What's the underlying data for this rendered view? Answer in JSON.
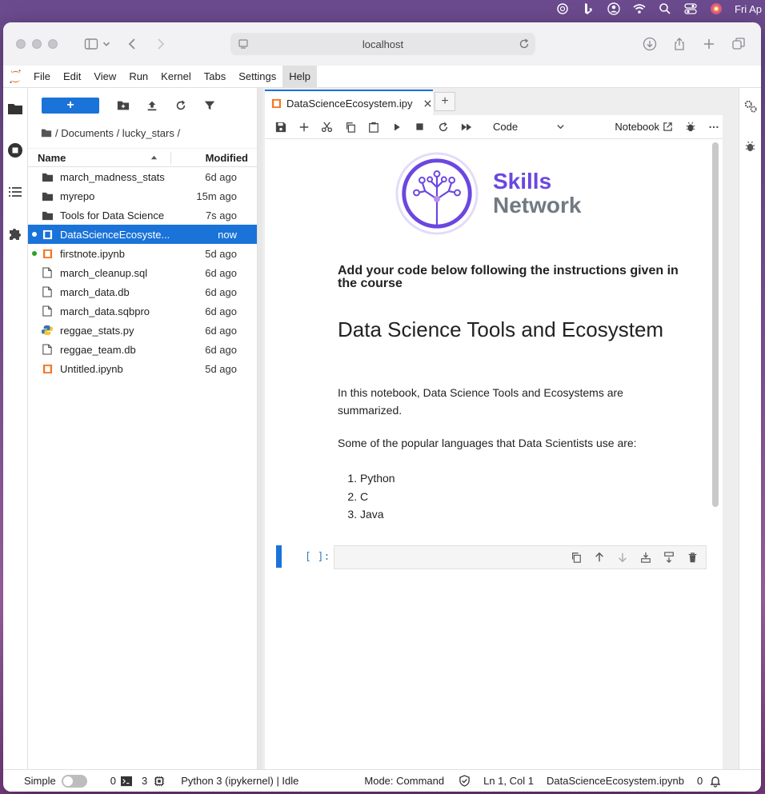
{
  "menubar": {
    "clock": "Fri Ap"
  },
  "browser": {
    "url": "localhost"
  },
  "jupyter_menu": [
    "File",
    "Edit",
    "View",
    "Run",
    "Kernel",
    "Tabs",
    "Settings",
    "Help"
  ],
  "active_menu": "Help",
  "filebrowser": {
    "new_label": "+",
    "breadcrumb": "/ Documents / lucky_stars /",
    "col_name": "Name",
    "col_modified": "Modified",
    "files": [
      {
        "name": "march_madness_stats",
        "modified": "6d ago",
        "type": "folder"
      },
      {
        "name": "myrepo",
        "modified": "15m ago",
        "type": "folder"
      },
      {
        "name": "Tools for Data Science",
        "modified": "7s ago",
        "type": "folder"
      },
      {
        "name": "DataScienceEcosyste...",
        "modified": "now",
        "type": "notebook",
        "selected": true,
        "dot": "#ffffff"
      },
      {
        "name": "firstnote.ipynb",
        "modified": "5d ago",
        "type": "notebook",
        "dot": "#2ca02c"
      },
      {
        "name": "march_cleanup.sql",
        "modified": "6d ago",
        "type": "file"
      },
      {
        "name": "march_data.db",
        "modified": "6d ago",
        "type": "file"
      },
      {
        "name": "march_data.sqbpro",
        "modified": "6d ago",
        "type": "file"
      },
      {
        "name": "reggae_stats.py",
        "modified": "6d ago",
        "type": "python"
      },
      {
        "name": "reggae_team.db",
        "modified": "6d ago",
        "type": "file"
      },
      {
        "name": "Untitled.ipynb",
        "modified": "5d ago",
        "type": "notebook"
      }
    ]
  },
  "tab": {
    "title": "DataScienceEcosystem.ipy"
  },
  "nbtoolbar": {
    "cell_type": "Code",
    "kernel_link": "Notebook"
  },
  "notebook": {
    "logo_line1": "Skills",
    "logo_line2": "Network",
    "instructions": "Add your code below following the instructions given in the course",
    "title": "Data Science Tools and Ecosystem",
    "intro": "In this notebook, Data Science Tools and Ecosystems are summarized.",
    "languages_intro": "Some of the popular languages that Data Scientists use are:",
    "languages": [
      "Python",
      "C",
      "Java"
    ],
    "prompt": "[ ]:"
  },
  "statusbar": {
    "mode_label": "Simple",
    "terminals": "0",
    "kernels": "3",
    "kernel": "Python 3 (ipykernel) | Idle",
    "mode": "Mode: Command",
    "cursor": "Ln 1, Col 1",
    "filename": "DataScienceEcosystem.ipynb",
    "notifications": "0"
  },
  "colors": {
    "accent": "#1a73d9",
    "brand": "#6b47e0",
    "notebook_orange": "#f37726"
  }
}
